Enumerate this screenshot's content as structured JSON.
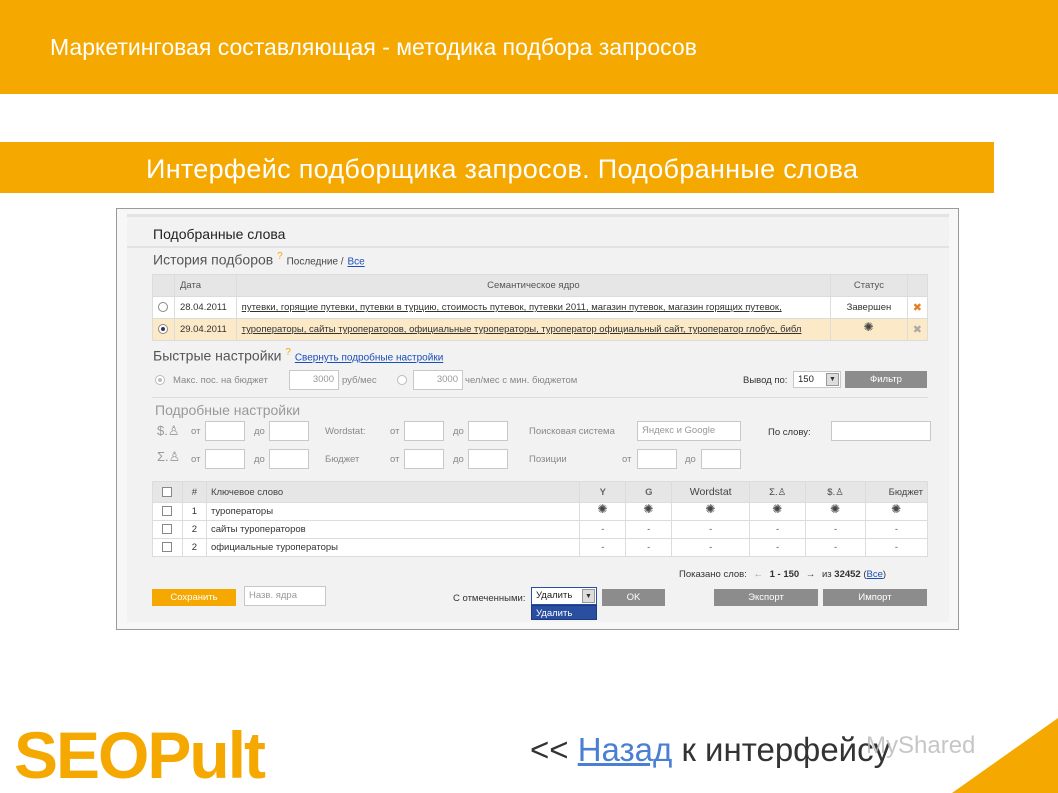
{
  "header": {
    "title": "Маркетинговая составляющая - методика подбора запросов"
  },
  "subheader": {
    "title": "Интерфейс подборщика запросов. Подобранные слова"
  },
  "panel": {
    "title": "Подобранные слова",
    "history": {
      "heading": "История подборов",
      "help": "?",
      "filter_last": "Последние /",
      "filter_all": "Все",
      "columns": [
        "Дата",
        "Семантическое ядро",
        "Статус"
      ],
      "rows": [
        {
          "date": "28.04.2011",
          "core": "путевки, горящие путевки, путевки в турцию, стоимость путевок, путевки 2011, магазин путевок, магазин горящих путевок,",
          "status": "Завершен",
          "selected": false
        },
        {
          "date": "29.04.2011",
          "core": "туроператоры, сайты туроператоров, официальные туроператоры, туроператор официальный сайт, туроператор глобус, библ",
          "status": "",
          "selected": true
        }
      ]
    },
    "quick": {
      "heading": "Быстрые настройки",
      "help": "?",
      "collapse_link": "Свернуть подробные настройки",
      "max_pos_label": "Макс. пос. на бюджет",
      "max_pos_value": "3000",
      "max_pos_unit": "руб/мес",
      "people_value": "3000",
      "people_label": "чел/мес с мин. бюджетом",
      "output_label": "Вывод по:",
      "output_value": "150",
      "filter_button": "Фильтр"
    },
    "detailed": {
      "heading": "Подробные настройки",
      "from": "от",
      "to": "до",
      "wordstat_label": "Wordstat:",
      "budget_label": "Бюджет",
      "search_system_label": "Поисковая система",
      "search_system_value": "Яндекс и Google",
      "positions_label": "Позиции",
      "by_word_label": "По слову:",
      "dollar_symbol": "$.",
      "sigma_symbol": "Σ."
    },
    "keywords": {
      "columns": {
        "num": "#",
        "keyword": "Ключевое слово",
        "y": "Y",
        "g": "G",
        "wordstat": "Wordstat",
        "sigma": "Σ.",
        "dollar": "$.",
        "budget": "Бюджет"
      },
      "rows": [
        {
          "num": "1",
          "keyword": "туроператоры",
          "y": "",
          "g": "",
          "wordstat": "",
          "sigma": "",
          "dollar": "",
          "budget": "",
          "loading": true
        },
        {
          "num": "2",
          "keyword": "сайты туроператоров",
          "y": "-",
          "g": "-",
          "wordstat": "-",
          "sigma": "-",
          "dollar": "-",
          "budget": "-",
          "loading": false
        },
        {
          "num": "2",
          "keyword": "официальные туроператоры",
          "y": "-",
          "g": "-",
          "wordstat": "-",
          "sigma": "-",
          "dollar": "-",
          "budget": "-",
          "loading": false
        }
      ]
    },
    "pager": {
      "shown_label": "Показано слов:",
      "prev": "←",
      "range": "1 - 150",
      "next": "→",
      "of_label": "из",
      "total": "32452",
      "all_open": "(",
      "all_link": "Все",
      "all_close": ")"
    },
    "bottom": {
      "save_button": "Сохранить",
      "core_name_placeholder": "Назв. ядра",
      "with_selected_label": "С отмеченными:",
      "action_value": "Удалить",
      "action_option": "Удалить",
      "ok_button": "OK",
      "export_button": "Экспорт",
      "import_button": "Импорт"
    }
  },
  "footer": {
    "logo_text": "SEOPult",
    "nav_prefix": "<<",
    "nav_link": "Назад",
    "nav_suffix": "к интерфейсу",
    "watermark": "MyShared"
  },
  "colors": {
    "accent": "#f5a800",
    "link": "#1a4fb8",
    "selected_row": "#fbe9c8"
  }
}
